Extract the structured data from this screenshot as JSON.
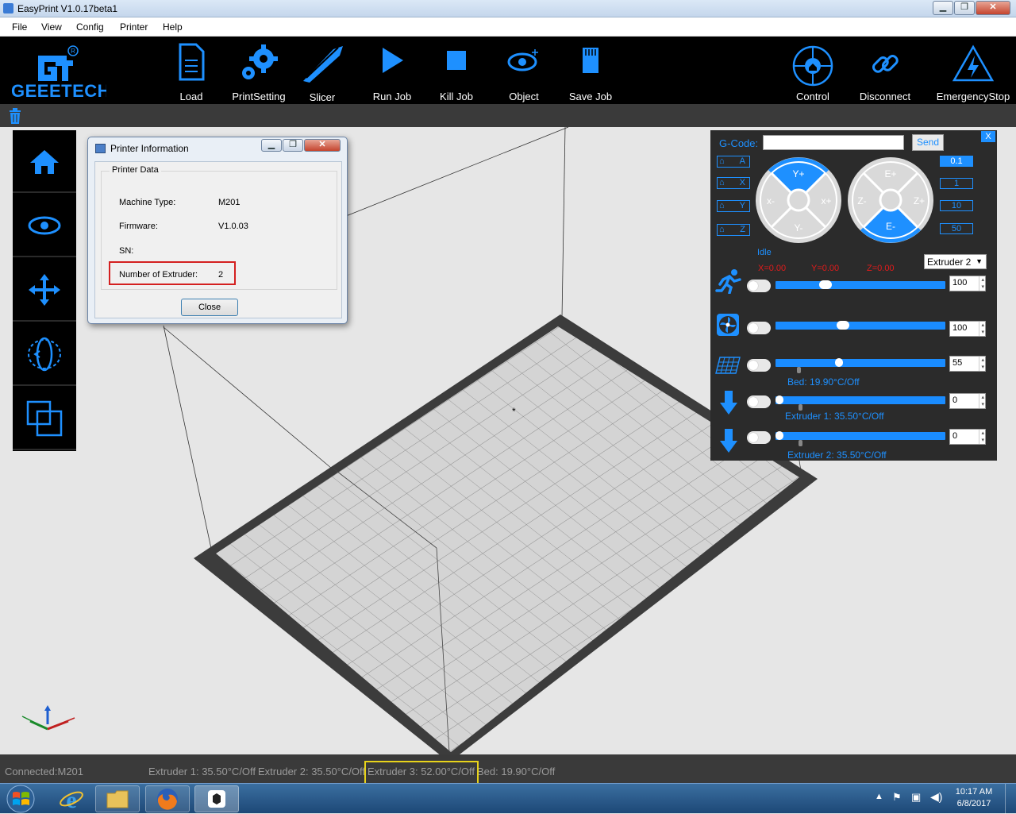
{
  "window": {
    "title": "EasyPrint   V1.0.17beta1"
  },
  "menu": [
    "File",
    "View",
    "Config",
    "Printer",
    "Help"
  ],
  "logo": {
    "text": "GEEETECH"
  },
  "toolbar": {
    "load": "Load",
    "printsetting": "PrintSetting",
    "slicer": "Slicer",
    "runjob": "Run Job",
    "killjob": "Kill Job",
    "object": "Object",
    "savejob": "Save Job",
    "control": "Control",
    "disconnect": "Disconnect",
    "emergency": "EmergencyStop"
  },
  "dialog": {
    "title": "Printer Information",
    "group": "Printer Data",
    "machine_type_label": "Machine Type:",
    "machine_type": "M201",
    "firmware_label": "Firmware:",
    "firmware": "V1.0.03",
    "sn_label": "SN:",
    "sn": "",
    "extruder_label": "Number of Extruder:",
    "extruder_count": "2",
    "close": "Close"
  },
  "control": {
    "gcode_label": "G-Code:",
    "gcode_value": "",
    "send": "Send",
    "close": "X",
    "home_buttons": [
      "A",
      "X",
      "Y",
      "Z"
    ],
    "steps": [
      "0.1",
      "1",
      "10",
      "50"
    ],
    "xy": {
      "y_plus": "Y+",
      "y_minus": "Y-",
      "x_minus": "x-",
      "x_plus": "x+"
    },
    "ze": {
      "e_plus": "E+",
      "e_minus": "E-",
      "z_minus": "Z-",
      "z_plus": "Z+"
    },
    "status": "Idle",
    "pos_x": "X=0.00",
    "pos_y": "Y=0.00",
    "pos_z": "Z=0.00",
    "extruder_select": "Extruder 2",
    "speed": "100",
    "fan": "100",
    "bed_target": "55",
    "bed_status": "Bed: 19.90°C/Off",
    "ext1_target": "0",
    "ext1_status": "Extruder 1: 35.50°C/Off",
    "ext2_target": "0",
    "ext2_status": "Extruder 2: 35.50°C/Off",
    "speed_level": 0.28,
    "fan_level": 0.39,
    "bed_level": 0.37,
    "ext1_level": 0.0,
    "ext2_level": 0.0
  },
  "status": {
    "connected": "Connected:M201",
    "ext1": "Extruder 1: 35.50°C/Off",
    "ext2": "Extruder 2: 35.50°C/Off",
    "ext3": "Extruder 3: 52.00°C/Off",
    "bed": "Bed: 19.90°C/Off"
  },
  "tray": {
    "time": "10:17 AM",
    "date": "6/8/2017"
  }
}
